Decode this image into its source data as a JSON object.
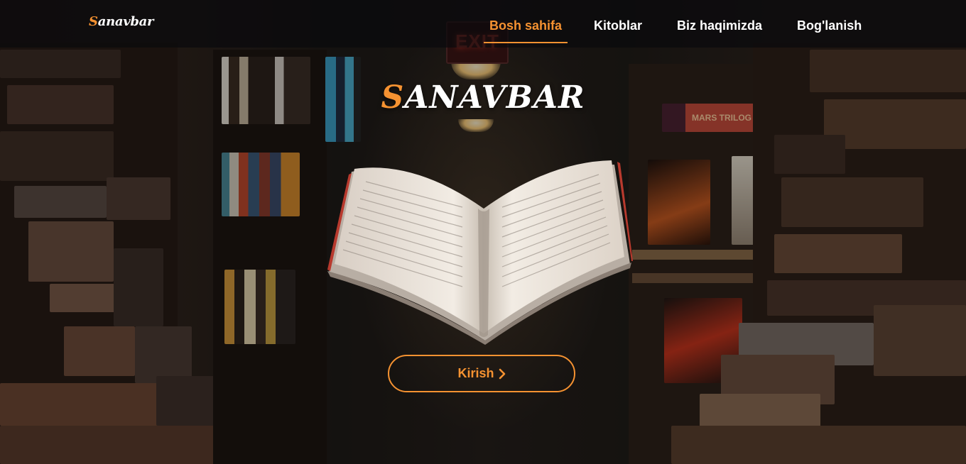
{
  "navbar": {
    "logo_first": "S",
    "logo_rest": "anavbar",
    "links": [
      {
        "label": "Bosh sahifa",
        "active": true
      },
      {
        "label": "Kitoblar",
        "active": false
      },
      {
        "label": "Biz haqimizda",
        "active": false
      },
      {
        "label": "Bog'lanish",
        "active": false
      }
    ]
  },
  "hero": {
    "title_first": "S",
    "title_rest": "ANAVBAR",
    "button_label": "Kirish",
    "button_icon": "chevron-right-icon"
  },
  "background": {
    "exit_sign": "EXIT",
    "shelf_label": "MARS TRILOG"
  },
  "colors": {
    "accent": "#f59231",
    "nav_background": "rgba(10,10,12,0.72)",
    "text": "#ffffff"
  }
}
